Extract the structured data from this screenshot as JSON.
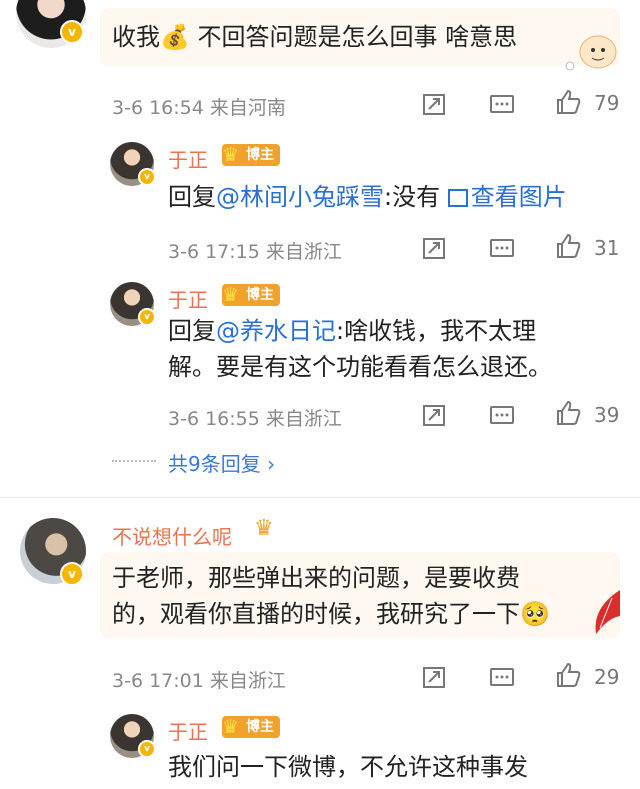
{
  "comments": [
    {
      "text_parts": [
        "收我",
        "💰",
        " 不回答问题是怎么回事 啥意思"
      ],
      "meta": "3-6 16:54 来自河南",
      "likes": "79"
    },
    {
      "name": "于正",
      "badge": "博主",
      "reply_prefix": "回复",
      "reply_to": "@林间小兔踩雪",
      "reply_text": ":没有 ",
      "view_image": "查看图片",
      "meta": "3-6 17:15 来自浙江",
      "likes": "31"
    },
    {
      "name": "于正",
      "badge": "博主",
      "reply_prefix": "回复",
      "reply_to": "@养水日记",
      "line1_rest": ":啥收钱，我不太理",
      "line2": "解。要是有这个功能看看怎么退还。",
      "meta": "3-6 16:55 来自浙江",
      "likes": "39"
    },
    {
      "more_replies": "共9条回复"
    },
    {
      "name": "不说想什么呢",
      "line1": "于老师，那些弹出来的问题，是要收费",
      "line2": "的，观看你直播的时候，我研究了一下",
      "emoji": "🥺",
      "meta": "3-6 17:01 来自浙江",
      "likes": "29"
    },
    {
      "name": "于正",
      "badge": "博主",
      "line1": "我们问一下微博，不允许这种事发"
    }
  ],
  "icons": {
    "share": "share-icon",
    "comment": "comment-icon",
    "like": "thumbs-up-icon",
    "verified": "verified-v-icon",
    "crown": "crown-icon"
  },
  "colors": {
    "name": "#eb7350",
    "link": "#2a6fd3",
    "badge": "#f1a22c",
    "verified": "#f7b500"
  }
}
